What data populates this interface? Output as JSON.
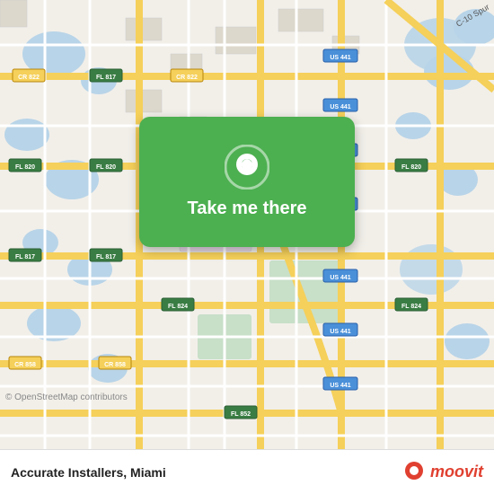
{
  "map": {
    "attribution": "© OpenStreetMap contributors",
    "center_lat": 26.05,
    "center_lon": -80.24
  },
  "overlay": {
    "button_label": "Take me there",
    "pin_icon": "location-pin"
  },
  "bottom_bar": {
    "location_name": "Accurate Installers,",
    "location_city": "Miami",
    "logo_text": "moovit"
  }
}
